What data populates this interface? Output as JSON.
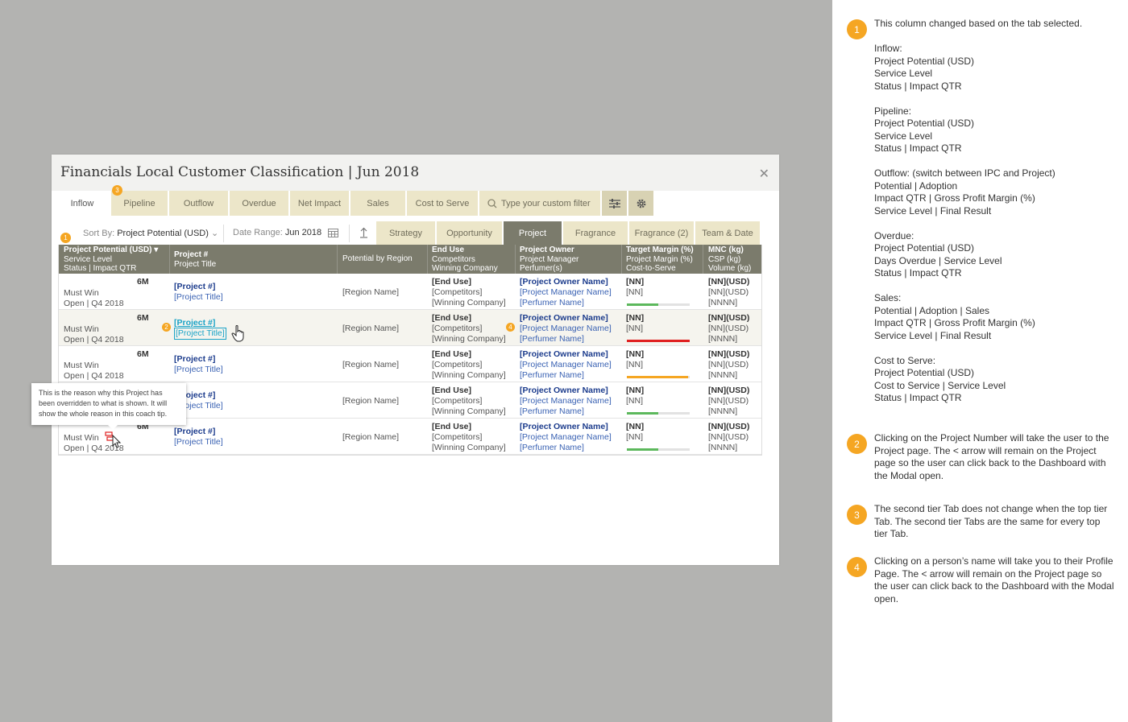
{
  "modal": {
    "title": "Financials Local Customer Classification | Jun 2018",
    "close_icon": "close-icon",
    "top_tabs": [
      "Inflow",
      "Pipeline",
      "Outflow",
      "Overdue",
      "Net Impact",
      "Sales",
      "Cost to Serve"
    ],
    "active_top_tab": "Inflow",
    "filter_placeholder": "Type your custom filter",
    "sort_label": "Sort By:",
    "sort_value": "Project Potential (USD)",
    "date_label": "Date Range:",
    "date_value": "Jun 2018",
    "second_tabs": [
      "Strategy",
      "Opportunity",
      "Project",
      "Fragrance",
      "Fragrance (2)",
      "Team & Date"
    ],
    "active_second_tab": "Project",
    "columns": {
      "c1": [
        "Project Potential (USD)",
        "Service Level",
        "Status | Impact QTR"
      ],
      "c2": [
        "Project #",
        "Project Title"
      ],
      "c3": [
        "Potential by Region"
      ],
      "c4": [
        "End Use",
        "Competitors",
        "Winning Company"
      ],
      "c5": [
        "Project Owner",
        "Project Manager",
        "Perfumer(s)"
      ],
      "c6": [
        "Target Margin (%)",
        "Project Margin (%)",
        "Cost-to-Serve"
      ],
      "c7": [
        "MNC (kg)",
        "CSP (kg)",
        "Volume (kg)"
      ]
    },
    "rows": [
      {
        "potential": "6M",
        "service": "Must Win",
        "status": "Open | Q4 2018",
        "project": "[Project #]",
        "title": "[Project Title]",
        "region": "[Region Name]",
        "end_use": "[End Use]",
        "competitors": "[Competitors]",
        "winning": "[Winning Company]",
        "owner": "[Project Owner Name]",
        "manager": "[Project Manager Name]",
        "perfumer": "[Perfumer Name]",
        "target": "[NN]",
        "margin": "[NN]",
        "mnc": "[NN](USD)",
        "csp": "[NN](USD)",
        "volume": "[NNNN]",
        "bar_fraction": 0.5,
        "bar_color": "#5cb85c"
      },
      {
        "potential": "6M",
        "service": "Must Win",
        "status": "Open | Q4 2018",
        "project": "[Project #]",
        "title": "[Project Title]",
        "region": "[Region Name]",
        "end_use": "[End Use]",
        "competitors": "[Competitors]",
        "winning": "[Winning Company]",
        "owner": "[Project Owner Name]",
        "manager": "[Project Manager Name]",
        "perfumer": "[Perfumer Name]",
        "target": "[NN]",
        "margin": "[NN]",
        "mnc": "[NN](USD)",
        "csp": "[NN](USD)",
        "volume": "[NNNN]",
        "bar_fraction": 1.0,
        "bar_color": "#e02020"
      },
      {
        "potential": "6M",
        "service": "Must Win",
        "status": "Open | Q4 2018",
        "project": "[Project #]",
        "title": "[Project Title]",
        "region": "[Region Name]",
        "end_use": "[End Use]",
        "competitors": "[Competitors]",
        "winning": "[Winning Company]",
        "owner": "[Project Owner Name]",
        "manager": "[Project Manager Name]",
        "perfumer": "[Perfumer Name]",
        "target": "[NN]",
        "margin": "[NN]",
        "mnc": "[NN](USD)",
        "csp": "[NN](USD)",
        "volume": "[NNNN]",
        "bar_fraction": 0.97,
        "bar_color": "#f5a623"
      },
      {
        "potential": "",
        "service": "",
        "status": "",
        "project": "[Project #]",
        "title": "[Project Title]",
        "region": "[Region Name]",
        "end_use": "[End Use]",
        "competitors": "[Competitors]",
        "winning": "[Winning Company]",
        "owner": "[Project Owner Name]",
        "manager": "[Project Manager Name]",
        "perfumer": "[Perfumer Name]",
        "target": "[NN]",
        "margin": "[NN]",
        "mnc": "[NN](USD)",
        "csp": "[NN](USD)",
        "volume": "[NNNN]",
        "bar_fraction": 0.5,
        "bar_color": "#5cb85c"
      },
      {
        "potential": "6M",
        "service": "Must Win",
        "status": "Open | Q4 2018",
        "project": "[Project #]",
        "title": "[Project Title]",
        "region": "[Region Name]",
        "end_use": "[End Use]",
        "competitors": "[Competitors]",
        "winning": "[Winning Company]",
        "owner": "[Project Owner Name]",
        "manager": "[Project Manager Name]",
        "perfumer": "[Perfumer Name]",
        "target": "[NN]",
        "margin": "[NN]",
        "mnc": "[NN](USD)",
        "csp": "[NN](USD)",
        "volume": "[NNNN]",
        "bar_fraction": 0.5,
        "bar_color": "#5cb85c"
      }
    ],
    "tooltip": "This is the reason why this Project has been overridden to what is shown. It will show the whole reason in this coach tip.",
    "badges": {
      "b1": "1",
      "b2": "2",
      "b3": "3",
      "b4": "4"
    }
  },
  "notes": [
    {
      "num": "1",
      "lines": [
        "This column changed based on the tab selected.",
        "",
        "Inflow:",
        "Project Potential (USD)",
        "Service Level",
        "Status | Impact QTR",
        "",
        "Pipeline:",
        "Project Potential (USD)",
        "Service Level",
        "Status | Impact QTR",
        "",
        "Outflow: (switch between IPC and Project)",
        "Potential | Adoption",
        "Impact QTR | Gross Profit Margin (%)",
        "Service Level | Final Result",
        "",
        "Overdue:",
        "Project Potential (USD)",
        "Days Overdue | Service Level",
        "Status | Impact QTR",
        "",
        "Sales:",
        "Potential | Adoption | Sales",
        "Impact QTR | Gross Profit Margin (%)",
        "Service Level | Final Result",
        "",
        "Cost to Serve:",
        "Project Potential (USD)",
        "Cost to Service | Service Level",
        "Status | Impact QTR"
      ]
    },
    {
      "num": "2",
      "lines": [
        "Clicking on the Project Number will take the user to the Project page. The < arrow will remain on the Project page so the user can click back to the Dashboard with the Modal open."
      ]
    },
    {
      "num": "3",
      "lines": [
        "The second tier Tab does not change when the top tier Tab. The second tier Tabs are the same for every top tier Tab."
      ]
    },
    {
      "num": "4",
      "lines": [
        "Clicking on a person’s name will take you to their Profile Page. The < arrow will remain on the Project page so the user can click back to the Dashboard with the Modal open."
      ]
    }
  ]
}
